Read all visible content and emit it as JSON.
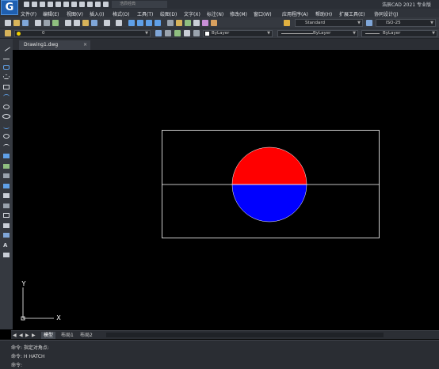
{
  "app": {
    "logo_letter": "G",
    "title": "浩辰CAD 2021 专业版",
    "quick_access_select": "浩辰经典"
  },
  "menu": [
    "文件(F)",
    "编辑(E)",
    "视图(V)",
    "插入(I)",
    "格式(O)",
    "工具(T)",
    "绘图(D)",
    "文字(X)",
    "标注(N)",
    "修改(M)",
    "窗口(W)",
    "应用程序(A)",
    "帮助(H)",
    "扩展工具(E)",
    "协同设计(J)"
  ],
  "toolbar": {
    "text_style": "Standard",
    "dim_style": "ISO-25"
  },
  "layers": {
    "current_layer": "0",
    "color": "ByLayer",
    "linetype": "ByLayer",
    "lineweight": "ByLayer"
  },
  "document_tab": "Drawing1.dwg",
  "layout_tabs": [
    "模型",
    "布局1",
    "布局2"
  ],
  "command_lines": [
    "命令: 指定对角点:",
    "命令: H HATCH",
    "命令:"
  ],
  "ucs": {
    "y_label": "Y",
    "x_label": "X"
  },
  "colors": {
    "canvas": "#000000",
    "top_half_fill": "#ff0000",
    "bottom_half_fill": "#0000ff",
    "lines": "#ffffff"
  }
}
